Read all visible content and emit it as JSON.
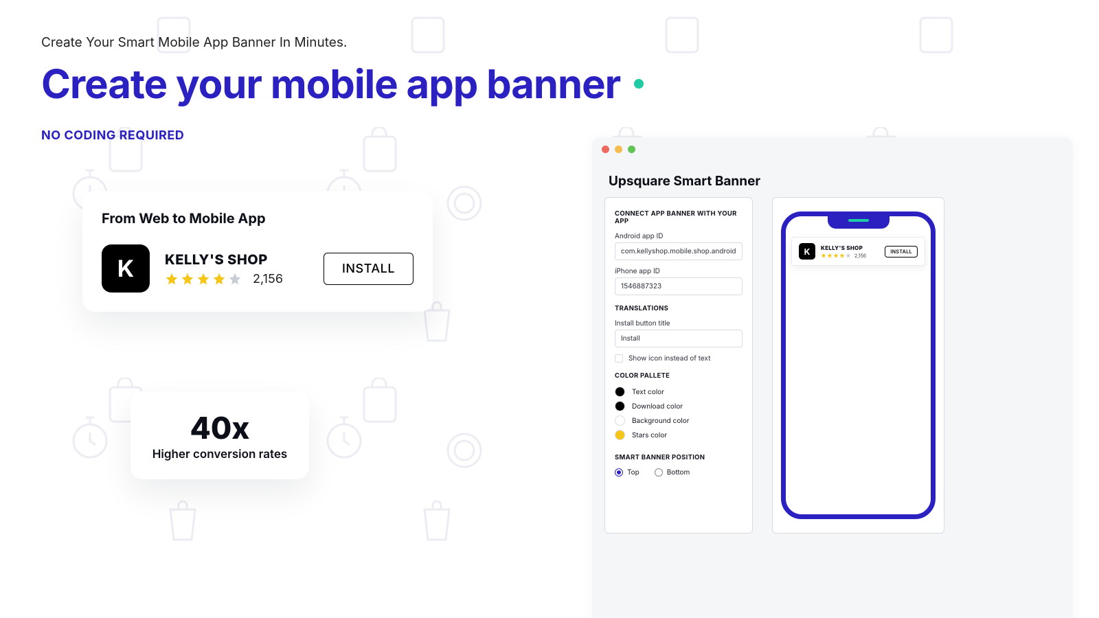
{
  "lead": "Create Your Smart Mobile App Banner In Minutes.",
  "title": "Create your mobile app banner",
  "sub": "NO CODING REQUIRED",
  "card1": {
    "heading": "From Web to Mobile App",
    "app_letter": "K",
    "app_name": "KELLY'S SHOP",
    "rating_count": "2,156",
    "install_label": "INSTALL",
    "stars_filled": 4,
    "stars_total": 5
  },
  "card2": {
    "value": "40x",
    "caption": "Higher conversion rates"
  },
  "panel": {
    "title": "Upsquare Smart Banner",
    "sections": {
      "connect": "CONNECT APP BANNER WITH YOUR APP",
      "translations": "TRANSLATIONS",
      "palette": "COLOR PALLETE",
      "position": "SMART BANNER POSITION"
    },
    "labels": {
      "android_id": "Android app ID",
      "iphone_id": "iPhone app ID",
      "install_title": "Install button title",
      "show_icon": "Show icon instead of text",
      "text_color": "Text color",
      "download_color": "Download color",
      "background_color": "Background color",
      "stars_color": "Stars color",
      "top": "Top",
      "bottom": "Bottom"
    },
    "values": {
      "android_id": "com.kellyshop.mobile.shop.android",
      "iphone_id": "1546887323",
      "install_title": "Install",
      "position": "top"
    },
    "colors": {
      "text": "#000000",
      "download": "#000000",
      "background": "#FFFFFF",
      "stars": "#F5C518"
    }
  },
  "phone_preview": {
    "app_letter": "K",
    "app_name": "KELLY'S SHOP",
    "rating_count": "2,156",
    "install_label": "INSTALL",
    "stars_filled": 4,
    "stars_total": 5
  }
}
